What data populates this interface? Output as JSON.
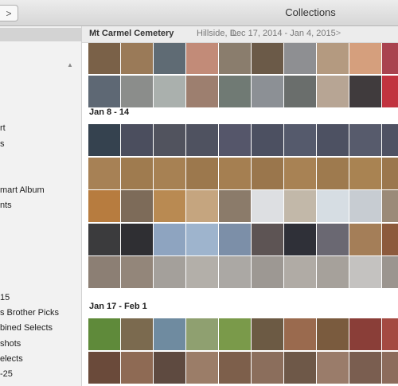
{
  "window": {
    "title": "Collections",
    "forward_glyph": ">"
  },
  "sidebar": {
    "items": [
      {
        "label": "rt"
      },
      {
        "label": "s"
      },
      {
        "label": "mart Album"
      },
      {
        "label": "nts"
      },
      {
        "label": "15"
      },
      {
        "label": "s Brother Picks"
      },
      {
        "label": "bined Selects"
      },
      {
        "label": "shots"
      },
      {
        "label": "elects"
      },
      {
        "label": "-25"
      }
    ]
  },
  "moment_header": {
    "title": "Mt Carmel Cemetery",
    "location": "Hillside, IL",
    "date_range": "Dec 17, 2014 - Jan 4, 2015",
    "chevron": ">"
  },
  "sections": [
    {
      "title": ""
    },
    {
      "title": "Jan 8 - 14"
    },
    {
      "title": "Jan 17 - Feb 1"
    }
  ],
  "colors": {
    "accent": "#3a3a3a",
    "sidebar_bg": "#f2f2f2",
    "header_bg": "#ebebeb"
  },
  "icons": {
    "nav_forward": "chevron-right-icon",
    "collapse": "triangle-up-icon"
  }
}
